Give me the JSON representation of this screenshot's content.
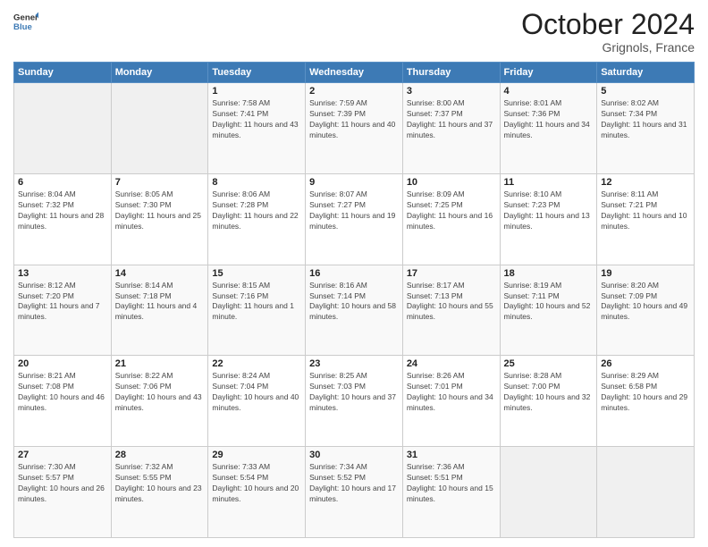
{
  "header": {
    "logo": {
      "line1": "General",
      "line2": "Blue"
    },
    "title": "October 2024",
    "location": "Grignols, France"
  },
  "days_of_week": [
    "Sunday",
    "Monday",
    "Tuesday",
    "Wednesday",
    "Thursday",
    "Friday",
    "Saturday"
  ],
  "weeks": [
    [
      {
        "day": "",
        "sunrise": "",
        "sunset": "",
        "daylight": ""
      },
      {
        "day": "",
        "sunrise": "",
        "sunset": "",
        "daylight": ""
      },
      {
        "day": "1",
        "sunrise": "Sunrise: 7:58 AM",
        "sunset": "Sunset: 7:41 PM",
        "daylight": "Daylight: 11 hours and 43 minutes."
      },
      {
        "day": "2",
        "sunrise": "Sunrise: 7:59 AM",
        "sunset": "Sunset: 7:39 PM",
        "daylight": "Daylight: 11 hours and 40 minutes."
      },
      {
        "day": "3",
        "sunrise": "Sunrise: 8:00 AM",
        "sunset": "Sunset: 7:37 PM",
        "daylight": "Daylight: 11 hours and 37 minutes."
      },
      {
        "day": "4",
        "sunrise": "Sunrise: 8:01 AM",
        "sunset": "Sunset: 7:36 PM",
        "daylight": "Daylight: 11 hours and 34 minutes."
      },
      {
        "day": "5",
        "sunrise": "Sunrise: 8:02 AM",
        "sunset": "Sunset: 7:34 PM",
        "daylight": "Daylight: 11 hours and 31 minutes."
      }
    ],
    [
      {
        "day": "6",
        "sunrise": "Sunrise: 8:04 AM",
        "sunset": "Sunset: 7:32 PM",
        "daylight": "Daylight: 11 hours and 28 minutes."
      },
      {
        "day": "7",
        "sunrise": "Sunrise: 8:05 AM",
        "sunset": "Sunset: 7:30 PM",
        "daylight": "Daylight: 11 hours and 25 minutes."
      },
      {
        "day": "8",
        "sunrise": "Sunrise: 8:06 AM",
        "sunset": "Sunset: 7:28 PM",
        "daylight": "Daylight: 11 hours and 22 minutes."
      },
      {
        "day": "9",
        "sunrise": "Sunrise: 8:07 AM",
        "sunset": "Sunset: 7:27 PM",
        "daylight": "Daylight: 11 hours and 19 minutes."
      },
      {
        "day": "10",
        "sunrise": "Sunrise: 8:09 AM",
        "sunset": "Sunset: 7:25 PM",
        "daylight": "Daylight: 11 hours and 16 minutes."
      },
      {
        "day": "11",
        "sunrise": "Sunrise: 8:10 AM",
        "sunset": "Sunset: 7:23 PM",
        "daylight": "Daylight: 11 hours and 13 minutes."
      },
      {
        "day": "12",
        "sunrise": "Sunrise: 8:11 AM",
        "sunset": "Sunset: 7:21 PM",
        "daylight": "Daylight: 11 hours and 10 minutes."
      }
    ],
    [
      {
        "day": "13",
        "sunrise": "Sunrise: 8:12 AM",
        "sunset": "Sunset: 7:20 PM",
        "daylight": "Daylight: 11 hours and 7 minutes."
      },
      {
        "day": "14",
        "sunrise": "Sunrise: 8:14 AM",
        "sunset": "Sunset: 7:18 PM",
        "daylight": "Daylight: 11 hours and 4 minutes."
      },
      {
        "day": "15",
        "sunrise": "Sunrise: 8:15 AM",
        "sunset": "Sunset: 7:16 PM",
        "daylight": "Daylight: 11 hours and 1 minute."
      },
      {
        "day": "16",
        "sunrise": "Sunrise: 8:16 AM",
        "sunset": "Sunset: 7:14 PM",
        "daylight": "Daylight: 10 hours and 58 minutes."
      },
      {
        "day": "17",
        "sunrise": "Sunrise: 8:17 AM",
        "sunset": "Sunset: 7:13 PM",
        "daylight": "Daylight: 10 hours and 55 minutes."
      },
      {
        "day": "18",
        "sunrise": "Sunrise: 8:19 AM",
        "sunset": "Sunset: 7:11 PM",
        "daylight": "Daylight: 10 hours and 52 minutes."
      },
      {
        "day": "19",
        "sunrise": "Sunrise: 8:20 AM",
        "sunset": "Sunset: 7:09 PM",
        "daylight": "Daylight: 10 hours and 49 minutes."
      }
    ],
    [
      {
        "day": "20",
        "sunrise": "Sunrise: 8:21 AM",
        "sunset": "Sunset: 7:08 PM",
        "daylight": "Daylight: 10 hours and 46 minutes."
      },
      {
        "day": "21",
        "sunrise": "Sunrise: 8:22 AM",
        "sunset": "Sunset: 7:06 PM",
        "daylight": "Daylight: 10 hours and 43 minutes."
      },
      {
        "day": "22",
        "sunrise": "Sunrise: 8:24 AM",
        "sunset": "Sunset: 7:04 PM",
        "daylight": "Daylight: 10 hours and 40 minutes."
      },
      {
        "day": "23",
        "sunrise": "Sunrise: 8:25 AM",
        "sunset": "Sunset: 7:03 PM",
        "daylight": "Daylight: 10 hours and 37 minutes."
      },
      {
        "day": "24",
        "sunrise": "Sunrise: 8:26 AM",
        "sunset": "Sunset: 7:01 PM",
        "daylight": "Daylight: 10 hours and 34 minutes."
      },
      {
        "day": "25",
        "sunrise": "Sunrise: 8:28 AM",
        "sunset": "Sunset: 7:00 PM",
        "daylight": "Daylight: 10 hours and 32 minutes."
      },
      {
        "day": "26",
        "sunrise": "Sunrise: 8:29 AM",
        "sunset": "Sunset: 6:58 PM",
        "daylight": "Daylight: 10 hours and 29 minutes."
      }
    ],
    [
      {
        "day": "27",
        "sunrise": "Sunrise: 7:30 AM",
        "sunset": "Sunset: 5:57 PM",
        "daylight": "Daylight: 10 hours and 26 minutes."
      },
      {
        "day": "28",
        "sunrise": "Sunrise: 7:32 AM",
        "sunset": "Sunset: 5:55 PM",
        "daylight": "Daylight: 10 hours and 23 minutes."
      },
      {
        "day": "29",
        "sunrise": "Sunrise: 7:33 AM",
        "sunset": "Sunset: 5:54 PM",
        "daylight": "Daylight: 10 hours and 20 minutes."
      },
      {
        "day": "30",
        "sunrise": "Sunrise: 7:34 AM",
        "sunset": "Sunset: 5:52 PM",
        "daylight": "Daylight: 10 hours and 17 minutes."
      },
      {
        "day": "31",
        "sunrise": "Sunrise: 7:36 AM",
        "sunset": "Sunset: 5:51 PM",
        "daylight": "Daylight: 10 hours and 15 minutes."
      },
      {
        "day": "",
        "sunrise": "",
        "sunset": "",
        "daylight": ""
      },
      {
        "day": "",
        "sunrise": "",
        "sunset": "",
        "daylight": ""
      }
    ]
  ]
}
